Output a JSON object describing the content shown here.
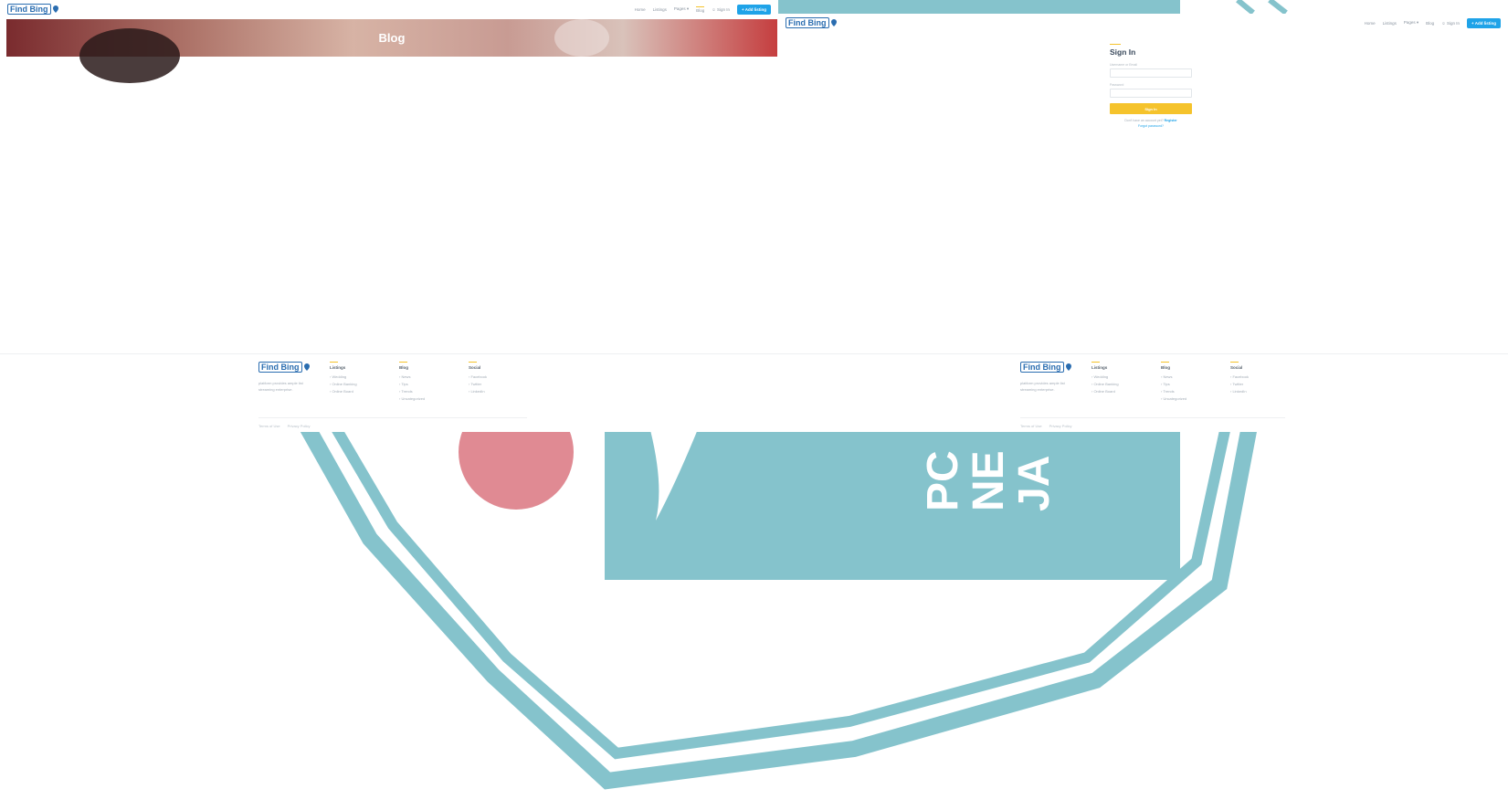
{
  "colors": {
    "stamp": "#85c3cc",
    "stamp_circle": "#e08a93",
    "accent_yellow": "#f5c32c",
    "accent_blue": "#1fa3e8",
    "text_dark": "#3a4a5c",
    "text_muted": "#a3acb6"
  },
  "stamp": {
    "letters_row1": "PC",
    "letters_row2": "NE",
    "letters_row3": "JA"
  },
  "brand": {
    "logo_text": "Find Bing",
    "pin_icon": "map-pin-icon"
  },
  "nav": {
    "items": [
      "Home",
      "Listings",
      "Pages ▾",
      "Blog",
      "Sign In"
    ],
    "active_item": "Blog",
    "sign_in_icon": "user-icon",
    "add_listing": "+ Add listing"
  },
  "blog_page": {
    "hero_title": "Blog"
  },
  "signin_page": {
    "title": "Sign In",
    "username_label": "Username or Email",
    "password_label": "Password",
    "submit_label": "Sign In",
    "register_prompt": "Don't have an account yet?",
    "register_link": "Register",
    "forgot_link": "Forgot password?"
  },
  "footer": {
    "about": "platform provides ample list streaming enterprise.",
    "columns": [
      {
        "title": "Listings",
        "items": [
          "› Wedding",
          "› Online Banking",
          "› Online Board"
        ]
      },
      {
        "title": "Blog",
        "items": [
          "› News",
          "› Tips",
          "› Trends",
          "› Uncategorized"
        ]
      },
      {
        "title": "Social",
        "items": [
          "› Facebook",
          "› Twitter",
          "› LinkedIn"
        ]
      }
    ],
    "bottom_links": [
      "Terms of Use",
      "Privacy Policy"
    ]
  }
}
